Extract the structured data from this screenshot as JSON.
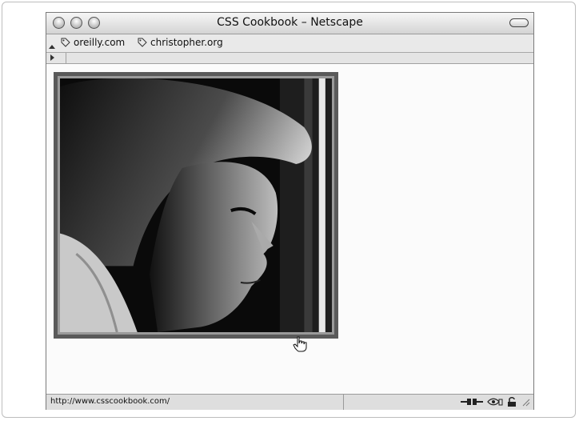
{
  "window": {
    "title": "CSS Cookbook – Netscape"
  },
  "bookmarks": [
    {
      "label": "oreilly.com",
      "icon": "tag-icon"
    },
    {
      "label": "christopher.org",
      "icon": "tag-icon"
    }
  ],
  "content": {
    "image": "photo-portrait"
  },
  "status": {
    "url": "http://www.csscookbook.com/",
    "icons": [
      "connection-icon",
      "visibility-icon",
      "lock-icon",
      "resize-grip-icon"
    ]
  },
  "colors": {
    "frame_outer": "#5a5a5a",
    "frame_inner": "#9a9a9a"
  }
}
